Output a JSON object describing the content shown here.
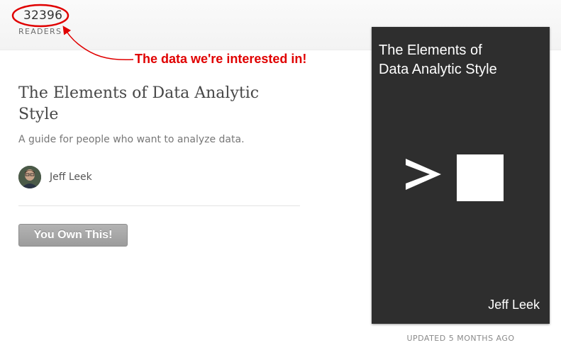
{
  "stats": {
    "reader_count": "32396",
    "readers_label": "READERS"
  },
  "annotation": {
    "text": "The data we're interested in!",
    "color": "#e00000",
    "icon": "red-ellipse-and-arrow"
  },
  "book": {
    "title": "The Elements of Data Analytic Style",
    "subtitle": "A guide for people who want to analyze data.",
    "author": "Jeff Leek",
    "own_button_label": "You Own This!",
    "updated_label": "UPDATED 5 MONTHS AGO"
  },
  "cover": {
    "title_line1": "The Elements of",
    "title_line2": "Data Analytic Style",
    "author": "Jeff Leek",
    "background": "#2e2e2e",
    "icon": "terminal-prompt-icon"
  }
}
